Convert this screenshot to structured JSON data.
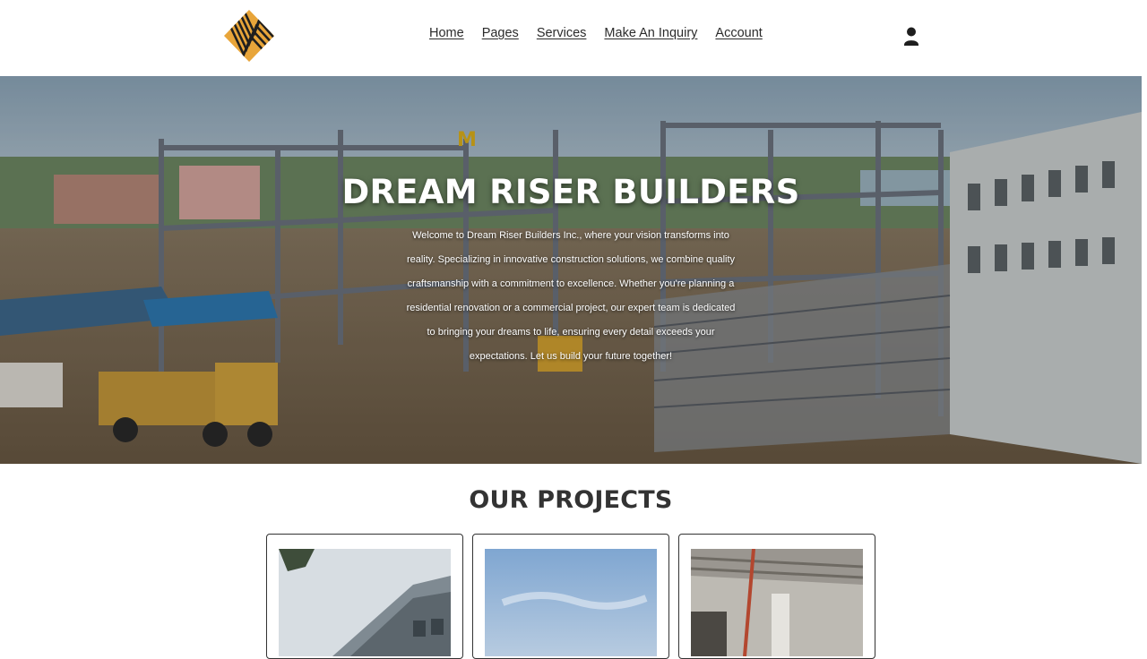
{
  "header": {
    "logo_icon": "dream-riser-builders-logo",
    "nav": [
      {
        "label": "Home"
      },
      {
        "label": "Pages"
      },
      {
        "label": "Services"
      },
      {
        "label": "Make An Inquiry"
      },
      {
        "label": "Account"
      }
    ],
    "account_icon": "user-icon"
  },
  "hero": {
    "title": "DREAM RISER BUILDERS",
    "lines": [
      "Welcome to Dream Riser Builders Inc., where your vision transforms into",
      "reality. Specializing in innovative construction solutions, we combine quality",
      "craftsmanship with a commitment to excellence. Whether you're planning a",
      "residential renovation or a commercial project, our expert team is dedicated",
      "to bringing your dreams to life, ensuring every detail exceeds your",
      "expectations. Let us build your future together!"
    ],
    "background_image": "construction-site-steel-frame-photo"
  },
  "projects": {
    "title": "OUR PROJECTS",
    "items": [
      {
        "image": "building-exterior-photo"
      },
      {
        "image": "sky-construction-photo"
      },
      {
        "image": "interior-structure-photo"
      }
    ]
  },
  "colors": {
    "logo_gold": "#e8a53a",
    "logo_dark": "#1f1f1f",
    "text_dark": "#333333",
    "sky": "#9ab6c9"
  }
}
